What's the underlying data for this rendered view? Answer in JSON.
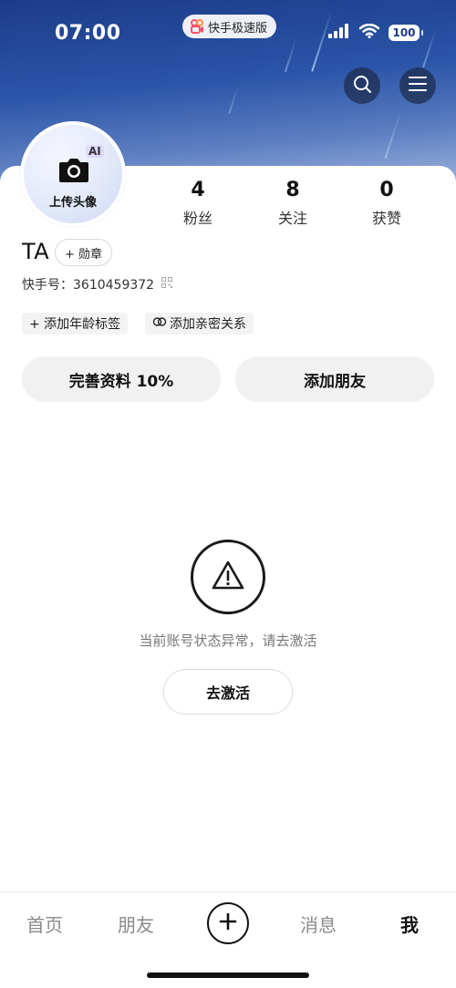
{
  "status_bar": {
    "time": "07:00",
    "app_name": "快手极速版",
    "battery": "100",
    "icons": [
      "signal-icon",
      "wifi-icon",
      "battery-icon"
    ]
  },
  "header": {
    "search_icon": "search-icon",
    "menu_icon": "menu-icon"
  },
  "profile": {
    "avatar_ai_badge": "AI",
    "avatar_upload_label": "上传头像",
    "stats": [
      {
        "value": "4",
        "label": "粉丝"
      },
      {
        "value": "8",
        "label": "关注"
      },
      {
        "value": "0",
        "label": "获赞"
      }
    ],
    "username": "TA",
    "medal_label": "+ 勋章",
    "kwai_id": "快手号：3610459372",
    "tags": [
      "+ 添加年龄标签",
      "添加亲密关系"
    ],
    "complete_profile_label": "完善资料 10%",
    "add_friends_label": "添加朋友"
  },
  "warning": {
    "message": "当前账号状态异常，请去激活",
    "action_label": "去激活"
  },
  "bottom_nav": {
    "items": [
      "首页",
      "朋友",
      "消息",
      "我"
    ],
    "active": "我"
  },
  "colors": {
    "hero_top": "#1c3c8a",
    "hero_bottom": "#9bb0da",
    "button_bg": "#f1f1f1",
    "muted_text": "#777777"
  }
}
